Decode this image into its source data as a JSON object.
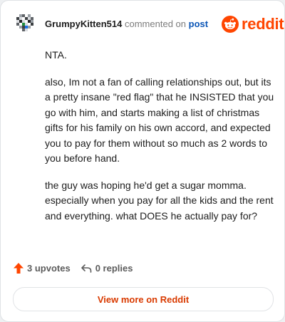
{
  "comment": {
    "username": "GrumpyKitten514",
    "action_text": "commented on",
    "post_link": "post",
    "avatar_icon": "pixel-avatar-icon",
    "paragraphs": [
      "NTA.",
      "also, Im not a fan of calling relationships out, but its a pretty insane \"red flag\" that he INSISTED that you go with him, and starts making a list of christmas gifts for his family on his own accord, and expected you to pay for them without so much as 2 words to you before hand.",
      "the guy was hoping he'd get a sugar momma. especially when you pay for all the kids and the rent and everything. what DOES he actually pay for?"
    ]
  },
  "brand": {
    "wordmark": "reddit",
    "logo_icon": "reddit-snoo-icon",
    "color": "#ff4500"
  },
  "footer": {
    "upvotes_label": "3 upvotes",
    "replies_label": "0 replies",
    "upvote_icon": "upvote-arrow-icon",
    "reply_icon": "reply-arrow-icon",
    "upvote_color": "#ff4500"
  },
  "cta": {
    "label": "View more on Reddit",
    "color": "#d93a00"
  }
}
